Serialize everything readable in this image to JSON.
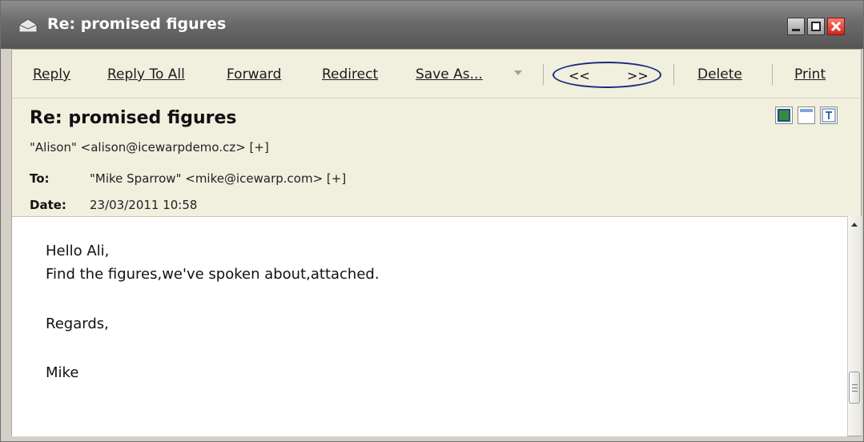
{
  "window": {
    "title": "Re: promised figures",
    "controls": [
      "minimize",
      "maximize",
      "close"
    ]
  },
  "toolbar": {
    "reply": "Reply",
    "reply_all": "Reply To All",
    "forward": "Forward",
    "redirect": "Redirect",
    "save_as": "Save As...",
    "prev": "<<",
    "next": ">>",
    "delete": "Delete",
    "print": "Print"
  },
  "message": {
    "subject": "Re: promised figures",
    "from": "\"Alison\" <alison@icewarpdemo.cz> [+]",
    "to_label": "To:",
    "to": "\"Mike Sparrow\" <mike@icewarp.com> [+]",
    "date_label": "Date:",
    "date": "23/03/2011 10:58",
    "body_lines": [
      "Hello Ali,",
      "Find the figures,we've spoken about,attached.",
      "Regards,",
      "Mike"
    ]
  },
  "icons": {
    "title": "envelope-icon",
    "view_buttons": [
      "image-view-icon",
      "plain-view-icon",
      "text-view-icon"
    ]
  },
  "colors": {
    "titlebar": "#6b6b6b",
    "panel": "#f1efde",
    "nav_oval": "#1b2c7a",
    "close": "#d2261c"
  }
}
